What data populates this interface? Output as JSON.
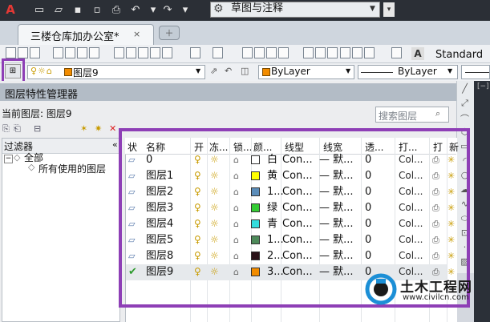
{
  "titlebar": {
    "workspace": "草图与注释"
  },
  "document_tab": {
    "label": "三楼仓库加办公室*",
    "close": "×"
  },
  "toolbar": {
    "text_style": "Standard"
  },
  "layer_toolbar": {
    "current_layer": "图层9",
    "color": "ByLayer",
    "linetype": "ByLayer",
    "current_color": "#f28c00"
  },
  "palette": {
    "title": "图层特性管理器",
    "current_layer_label": "当前图层: 图层9",
    "search_placeholder": "搜索图层",
    "filter_header": "过滤器",
    "filter_tree": [
      "全部",
      "所有使用的图层"
    ]
  },
  "grid": {
    "columns": [
      "状",
      "名称",
      "开",
      "冻...",
      "锁...",
      "颜...",
      "线型",
      "线宽",
      "透...",
      "打...",
      "打",
      "新"
    ],
    "rows": [
      {
        "name": "0",
        "color_name": "白",
        "color": "#ffffff",
        "linetype": "Con...",
        "lineweight": "— 默...",
        "transparency": "0",
        "plot_style": "Col...",
        "current": false
      },
      {
        "name": "图层1",
        "color_name": "黄",
        "color": "#ffff00",
        "linetype": "Con...",
        "lineweight": "— 默...",
        "transparency": "0",
        "plot_style": "Col...",
        "current": false
      },
      {
        "name": "图层2",
        "color_name": "1...",
        "color": "#5b8dba",
        "linetype": "Con...",
        "lineweight": "— 默...",
        "transparency": "0",
        "plot_style": "Col...",
        "current": false
      },
      {
        "name": "图层3",
        "color_name": "绿",
        "color": "#33cc33",
        "linetype": "Con...",
        "lineweight": "— 默...",
        "transparency": "0",
        "plot_style": "Col...",
        "current": false
      },
      {
        "name": "图层4",
        "color_name": "青",
        "color": "#33dddd",
        "linetype": "Con...",
        "lineweight": "— 默...",
        "transparency": "0",
        "plot_style": "Col...",
        "current": false
      },
      {
        "name": "图层5",
        "color_name": "1...",
        "color": "#4d8a5a",
        "linetype": "Con...",
        "lineweight": "— 默...",
        "transparency": "0",
        "plot_style": "Col...",
        "current": false
      },
      {
        "name": "图层8",
        "color_name": "2...",
        "color": "#2a1218",
        "linetype": "Con...",
        "lineweight": "— 默...",
        "transparency": "0",
        "plot_style": "Col...",
        "current": false
      },
      {
        "name": "图层9",
        "color_name": "3...",
        "color": "#f28c00",
        "linetype": "Con...",
        "lineweight": "— 默...",
        "transparency": "0",
        "plot_style": "Col...",
        "current": true
      }
    ]
  },
  "watermark": {
    "title": "土木工程网",
    "url": "www.civilcn.com"
  },
  "accent_color": "#8e3fb6"
}
